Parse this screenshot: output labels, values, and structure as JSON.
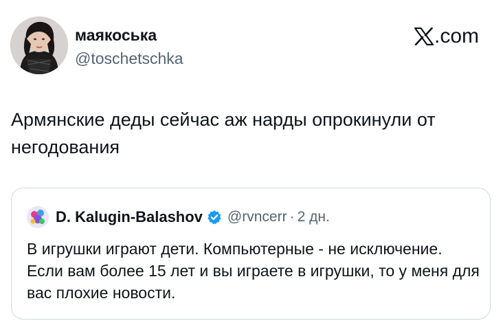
{
  "author": {
    "name": "маякоська",
    "handle": "@toschetschka"
  },
  "brand": {
    "logo_text": ".com",
    "logo_icon": "x-logo-icon"
  },
  "tweet": {
    "text": "Армянские деды сейчас аж нарды опрокинули от негодования"
  },
  "quote": {
    "name": "D. Kalugin-Balashov",
    "verified_icon": "verified-badge-icon",
    "handle": "@rvncerr",
    "separator": "·",
    "time": "2 дн.",
    "text": "В игрушки играют дети. Компьютерные - не исключение. Если вам более 15 лет и вы играете в игрушки, то у меня для вас плохие новости."
  },
  "colors": {
    "text": "#0f1419",
    "secondary": "#536471",
    "border": "#cfd9de",
    "verified": "#1d9bf0"
  }
}
